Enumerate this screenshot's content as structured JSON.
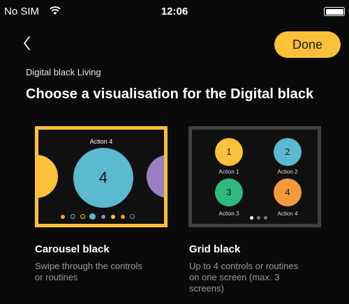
{
  "status_bar": {
    "carrier": "No SIM",
    "time": "12:06"
  },
  "nav": {
    "done_label": "Done"
  },
  "header": {
    "subtitle": "Digital black Living",
    "title": "Choose a visualisation for the Digital black"
  },
  "options": [
    {
      "name": "Carousel black",
      "description_lines": [
        "Swipe through the controls",
        "or routines"
      ],
      "selected": true,
      "preview": {
        "action_title": "Action 4",
        "center_number": "4"
      }
    },
    {
      "name": "Grid black",
      "description_lines": [
        "Up to 4 controls or routines",
        "on one screen (max. 3",
        "screens)"
      ],
      "selected": false,
      "preview": {
        "tiles": [
          {
            "number": "1",
            "label": "Action 1",
            "color": "#fcc13a"
          },
          {
            "number": "2",
            "label": "Action 2",
            "color": "#5bbad0"
          },
          {
            "number": "3",
            "label": "Action 3",
            "color": "#2fb97d"
          },
          {
            "number": "4",
            "label": "Action 4",
            "color": "#f39a3b"
          }
        ]
      }
    }
  ],
  "colors": {
    "accent": "#fcc13a",
    "teal": "#5bbad0",
    "purple": "#9b7fc2",
    "background": "#0a0a0a"
  }
}
